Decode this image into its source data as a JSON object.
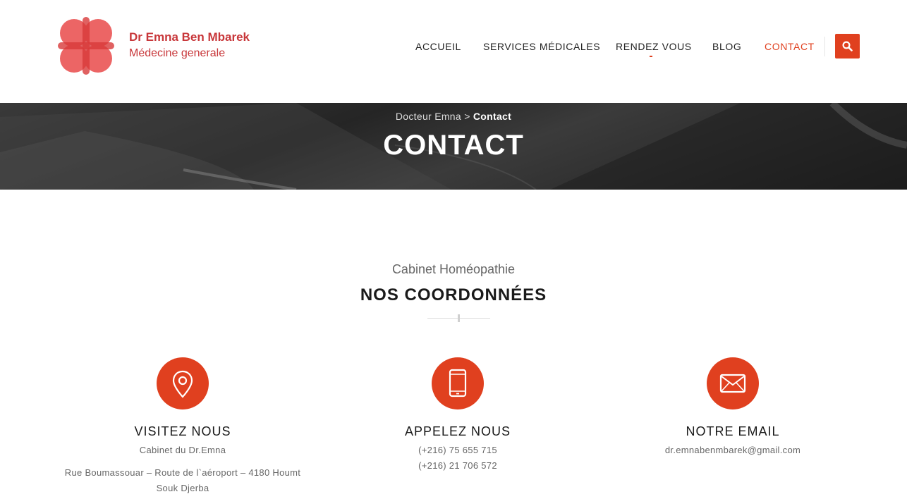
{
  "brand": {
    "name": "Dr Emna Ben Mbarek",
    "subtitle": "Médecine generale",
    "logo_icon": "cross-heart-logo-icon",
    "color": "#c8373a"
  },
  "nav": {
    "items": [
      {
        "label": "ACCUEIL"
      },
      {
        "label": "SERVICES MÉDICALES"
      },
      {
        "label": "RENDEZ VOUS"
      },
      {
        "label": "BLOG"
      },
      {
        "label": "CONTACT",
        "active": true
      }
    ],
    "search_icon": "search-icon",
    "accent": "#e0401f"
  },
  "banner": {
    "breadcrumb_home": "Docteur Emna",
    "breadcrumb_sep": ">",
    "breadcrumb_current": "Contact",
    "title": "CONTACT"
  },
  "section": {
    "kicker": "Cabinet Homéopathie",
    "title": "NOS COORDONNÉES"
  },
  "cards": [
    {
      "icon": "map-pin-icon",
      "title": "VISITEZ NOUS",
      "line1": "Cabinet du Dr.Emna",
      "line2": "Rue Boumassouar – Route de l`aéroport – 4180 Houmt Souk Djerba"
    },
    {
      "icon": "smartphone-icon",
      "title": "APPELEZ NOUS",
      "line1": "(+216) 75 655 715",
      "line2": "(+216) 21 706 572"
    },
    {
      "icon": "envelope-icon",
      "title": "NOTRE EMAIL",
      "line1": "dr.emnabenmbarek@gmail.com"
    }
  ]
}
